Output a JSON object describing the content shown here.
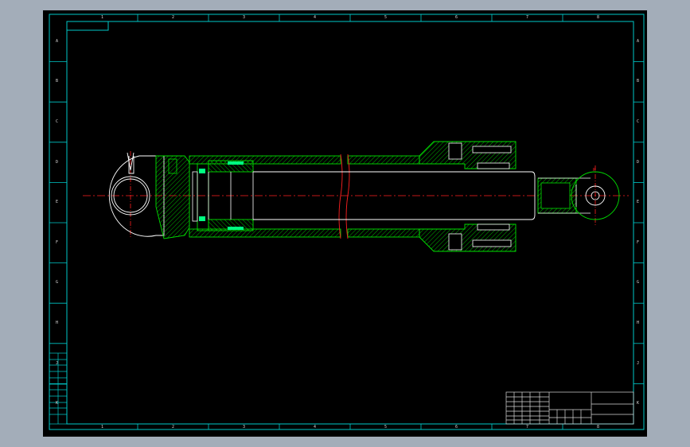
{
  "colors": {
    "page_background": "#a3adb9",
    "sheet_background": "#000000",
    "frame": "#00c8c8",
    "section_lines": "#00e000",
    "outline": "#ffffff",
    "centerline": "#ff2020",
    "highlight": "#00ff80"
  },
  "frame": {
    "top_zone_labels": [
      "1",
      "2",
      "3",
      "4",
      "5",
      "6",
      "7",
      "8"
    ],
    "bottom_zone_labels": [
      "1",
      "2",
      "3",
      "4",
      "5",
      "6",
      "7",
      "8"
    ],
    "left_zone_labels": [
      "A",
      "B",
      "C",
      "D",
      "E",
      "F",
      "G",
      "H",
      "J",
      "K"
    ],
    "right_zone_labels": [
      "A",
      "B",
      "C",
      "D",
      "E",
      "F",
      "G",
      "H",
      "J",
      "K"
    ]
  },
  "drawing": {
    "subject": "hydraulic-cylinder-section",
    "number_mark": "R"
  }
}
